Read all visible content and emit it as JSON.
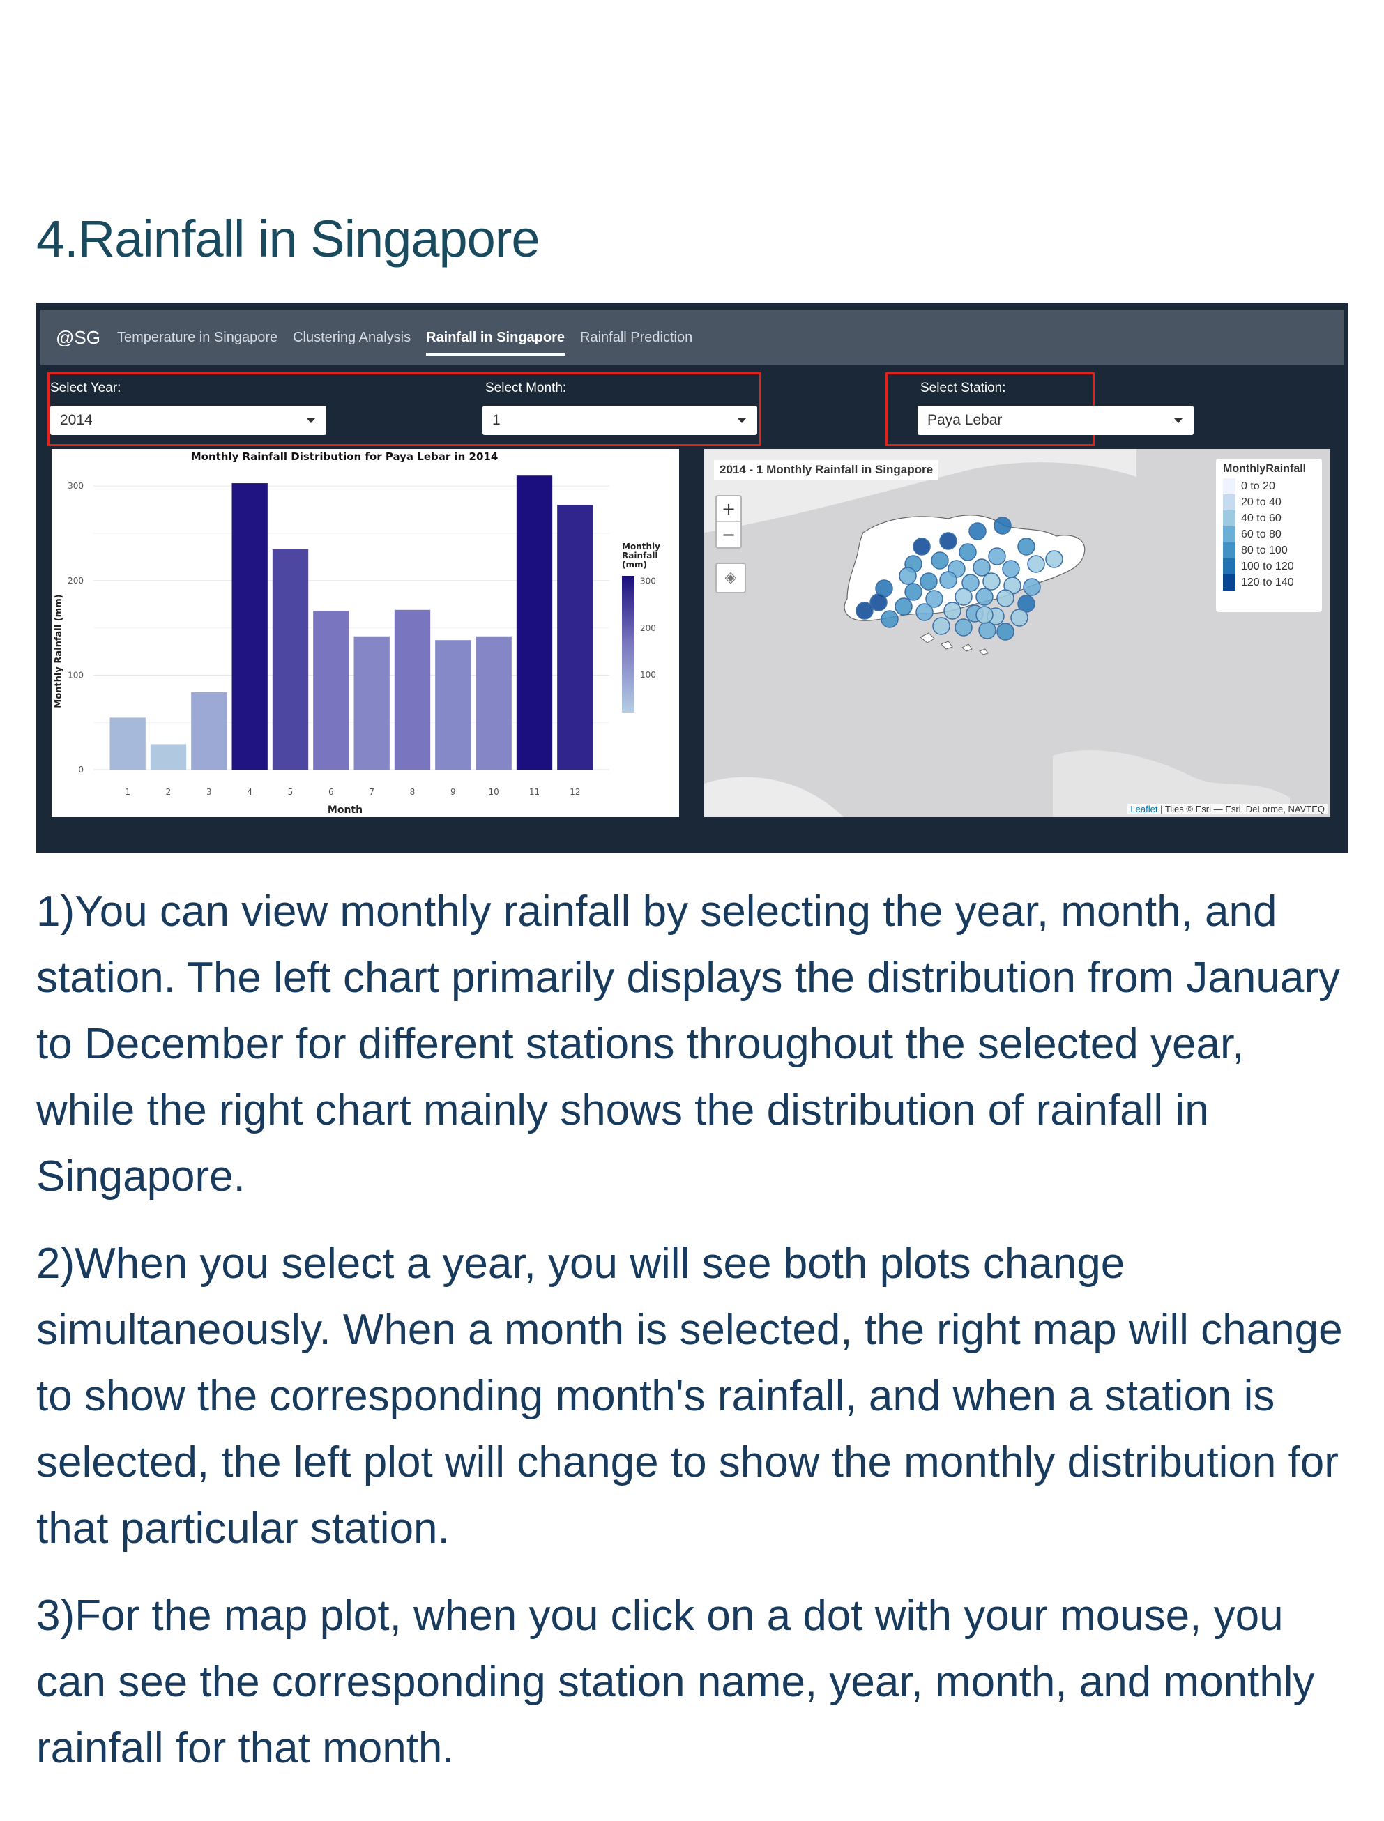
{
  "heading": "4.Rainfall in Singapore",
  "app": {
    "brand": "@SG",
    "tabs": [
      {
        "label": "Temperature in Singapore",
        "active": false
      },
      {
        "label": "Clustering Analysis",
        "active": false
      },
      {
        "label": "Rainfall in Singapore",
        "active": true
      },
      {
        "label": "Rainfall Prediction",
        "active": false
      }
    ],
    "controls": {
      "year": {
        "label": "Select Year:",
        "value": "2014"
      },
      "month": {
        "label": "Select Month:",
        "value": "1"
      },
      "station": {
        "label": "Select Station:",
        "value": "Paya Lebar"
      }
    },
    "colors": {
      "navbar": "#4a5563",
      "background": "#1b2838",
      "highlight_box": "#e0231c"
    }
  },
  "chart_data": [
    {
      "type": "bar",
      "title": "Monthly Rainfall Distribution for Paya Lebar in 2014",
      "xlabel": "Month",
      "ylabel": "Monthly Rainfall (mm)",
      "categories": [
        "1",
        "2",
        "3",
        "4",
        "5",
        "6",
        "7",
        "8",
        "9",
        "10",
        "11",
        "12"
      ],
      "values": [
        55,
        27,
        82,
        303,
        233,
        168,
        141,
        169,
        137,
        141,
        311,
        280
      ],
      "ylim": [
        0,
        320
      ],
      "yticks": [
        0,
        100,
        200,
        300
      ],
      "grid": true,
      "colorbar": {
        "title": "Monthly\nRainfall\n(mm)",
        "ticks": [
          100,
          200,
          300
        ],
        "low_color": "#b3cde3",
        "high_color": "#1b0e7e"
      }
    },
    {
      "type": "map",
      "title": "2014 - 1 Monthly Rainfall in Singapore",
      "legend_title": "MonthlyRainfall",
      "legend": [
        {
          "label": "0 to 20",
          "color": "#eff3ff"
        },
        {
          "label": "20 to 40",
          "color": "#c6dbef"
        },
        {
          "label": "40 to 60",
          "color": "#9ecae1"
        },
        {
          "label": "60 to 80",
          "color": "#6baed6"
        },
        {
          "label": "80 to 100",
          "color": "#4292c6"
        },
        {
          "label": "100 to 120",
          "color": "#2171b5"
        },
        {
          "label": "120 to 140",
          "color": "#084594"
        }
      ],
      "zoom_in": "+",
      "zoom_out": "−",
      "attribution_leaflet": "Leaflet",
      "attribution_tiles": " | Tiles © Esri — Esri, DeLorme, NAVTEQ"
    }
  ],
  "paragraphs": [
    "1)You can view monthly rainfall by selecting the year, month, and station. The left chart primarily displays the distribution from January to December for different stations throughout the selected year, while the right chart mainly shows the distribution of rainfall in Singapore.",
    "2)When you select a year, you will see both plots change simultaneously. When a month is selected, the right map will change to show the corresponding month's rainfall, and when a station is selected, the left plot will change to show the monthly distribution for that particular station.",
    "3)For the map plot, when you click on a dot with your mouse, you can see the corresponding station name, year, month, and monthly rainfall for that month."
  ]
}
